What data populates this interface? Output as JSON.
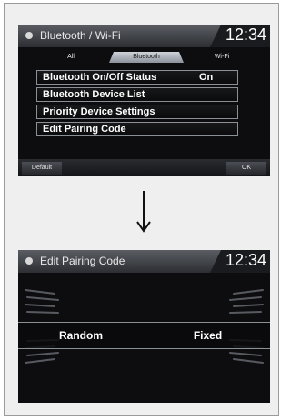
{
  "screen1": {
    "title": "Bluetooth / Wi-Fi",
    "clock": "12:34",
    "tabs": [
      {
        "label": "All"
      },
      {
        "label": "Bluetooth"
      },
      {
        "label": "Wi-Fi"
      }
    ],
    "items": [
      {
        "label": "Bluetooth On/Off Status",
        "value": "On"
      },
      {
        "label": "Bluetooth Device List"
      },
      {
        "label": "Priority Device Settings"
      },
      {
        "label": "Edit Pairing Code"
      }
    ],
    "bottom": {
      "default_label": "Default",
      "ok_label": "OK"
    }
  },
  "screen2": {
    "title": "Edit Pairing Code",
    "clock": "12:34",
    "options": [
      {
        "label": "Random"
      },
      {
        "label": "Fixed"
      }
    ]
  },
  "colors": {
    "screen_bg": "#0d0d0f",
    "selected_tab": "#cfd3da",
    "border": "#8b8f96"
  }
}
